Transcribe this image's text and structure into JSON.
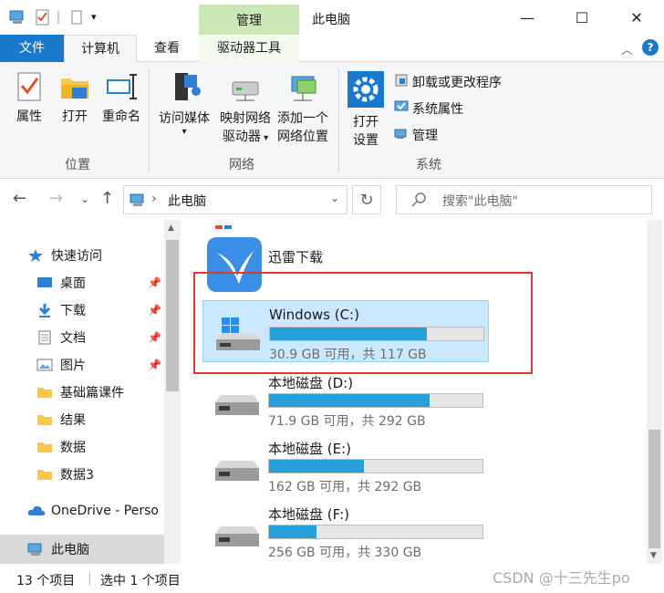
{
  "title_bar": {
    "context_tab": "管理",
    "window_title": "此电脑",
    "minimize": "—",
    "maximize": "☐",
    "close": "✕"
  },
  "tabs": {
    "file": "文件",
    "computer": "计算机",
    "view": "查看",
    "drive_tools": "驱动器工具"
  },
  "ribbon": {
    "properties": "属性",
    "open": "打开",
    "rename": "重命名",
    "location_group": "位置",
    "access_media_1": "访问媒体",
    "map_drive_1": "映射网络",
    "map_drive_2": "驱动器",
    "add_network_1": "添加一个",
    "add_network_2": "网络位置",
    "network_group": "网络",
    "open_settings_1": "打开",
    "open_settings_2": "设置",
    "uninstall": "卸载或更改程序",
    "system_props": "系统属性",
    "manage": "管理",
    "system_group": "系统"
  },
  "address": {
    "path": "此电脑",
    "search_placeholder": "搜索\"此电脑\""
  },
  "nav": {
    "quick_access": "快速访问",
    "desktop": "桌面",
    "downloads": "下载",
    "documents": "文档",
    "pictures": "图片",
    "folder1": "基础篇课件",
    "folder2": "结果",
    "folder3": "数据",
    "folder4": "数据3",
    "onedrive": "OneDrive - Perso",
    "this_pc": "此电脑"
  },
  "content": {
    "app_name": "迅雷下载",
    "drives": [
      {
        "name": "Windows (C:)",
        "info": "30.9 GB 可用，共 117 GB",
        "used_fraction": 0.736
      },
      {
        "name": "本地磁盘 (D:)",
        "info": "71.9 GB 可用，共 292 GB",
        "used_fraction": 0.754
      },
      {
        "name": "本地磁盘 (E:)",
        "info": "162 GB 可用，共 292 GB",
        "used_fraction": 0.445
      },
      {
        "name": "本地磁盘 (F:)",
        "info": "256 GB 可用，共 330 GB",
        "used_fraction": 0.224
      }
    ]
  },
  "status": {
    "count": "13 个项目",
    "selected": "选中 1 个项目"
  },
  "watermark": "CSDN @十三先生po",
  "colors": {
    "accent": "#1979ca",
    "bar_fill": "#26a0da",
    "highlight": "#e53535",
    "context_tab": "#cce8b6"
  }
}
